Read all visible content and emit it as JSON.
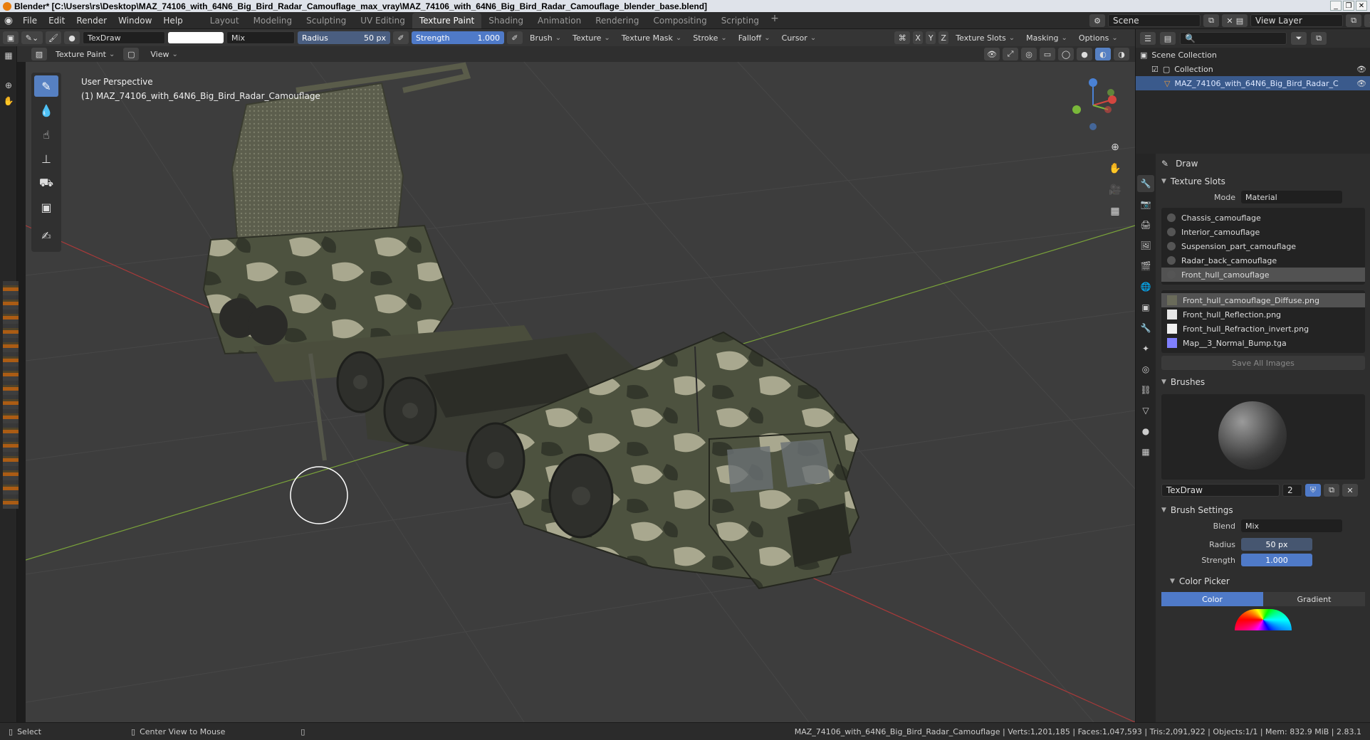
{
  "window": {
    "title": "Blender* [C:\\Users\\rs\\Desktop\\MAZ_74106_with_64N6_Big_Bird_Radar_Camouflage_max_vray\\MAZ_74106_with_64N6_Big_Bird_Radar_Camouflage_blender_base.blend]"
  },
  "menu": {
    "items": [
      "File",
      "Edit",
      "Render",
      "Window",
      "Help"
    ]
  },
  "workspaces": {
    "tabs": [
      "Layout",
      "Modeling",
      "Sculpting",
      "UV Editing",
      "Texture Paint",
      "Shading",
      "Animation",
      "Rendering",
      "Compositing",
      "Scripting"
    ],
    "active": "Texture Paint",
    "add": "+"
  },
  "scene": {
    "name": "Scene",
    "view_layer": "View Layer"
  },
  "toolsettings": {
    "brush_name": "TexDraw",
    "blend": "Mix",
    "radius_label": "Radius",
    "radius_value": "50 px",
    "strength_label": "Strength",
    "strength_value": "1.000",
    "dropdowns": [
      "Brush",
      "Texture",
      "Texture Mask",
      "Stroke",
      "Falloff",
      "Cursor"
    ],
    "axes": [
      "X",
      "Y",
      "Z"
    ],
    "right_dropdowns": [
      "Texture Slots",
      "Masking",
      "Options"
    ]
  },
  "header": {
    "mode": "Texture Paint",
    "view": "View"
  },
  "viewport": {
    "perspective": "User Perspective",
    "object_label": "(1) MAZ_74106_with_64N6_Big_Bird_Radar_Camouflage",
    "colors": {
      "background": "#3d3d3d",
      "grid": "#4a4a4a",
      "x_axis": "#a83a3a",
      "y_axis": "#7aa33a",
      "camo_dark": "#4d523f",
      "camo_light": "#a9a88f"
    }
  },
  "outliner": {
    "scene_collection": "Scene Collection",
    "collection": "Collection",
    "object": "MAZ_74106_with_64N6_Big_Bird_Radar_C"
  },
  "properties": {
    "tool_name": "Draw",
    "texture_slots_title": "Texture Slots",
    "mode_label": "Mode",
    "mode_value": "Material",
    "materials": [
      "Chassis_camouflage",
      "Interior_camouflage",
      "Suspension_part_camouflage",
      "Radar_back_camouflage",
      "Front_hull_camouflage"
    ],
    "active_material": "Front_hull_camouflage",
    "images": [
      "Front_hull_camouflage_Diffuse.png",
      "Front_hull_Reflection.png",
      "Front_hull_Refraction_invert.png",
      "Map__3_Normal_Bump.tga"
    ],
    "active_image": "Front_hull_camouflage_Diffuse.png",
    "save_all": "Save All Images",
    "brushes_title": "Brushes",
    "brush_name": "TexDraw",
    "brush_users": "2",
    "brush_settings_title": "Brush Settings",
    "blend_label": "Blend",
    "blend_value": "Mix",
    "radius_label": "Radius",
    "radius_value": "50 px",
    "strength_label": "Strength",
    "strength_value": "1.000",
    "color_picker_title": "Color Picker",
    "color_tab": "Color",
    "gradient_tab": "Gradient"
  },
  "statusbar": {
    "select": "Select",
    "center_view": "Center View to Mouse",
    "stats": "MAZ_74106_with_64N6_Big_Bird_Radar_Camouflage | Verts:1,201,185 | Faces:1,047,593 | Tris:2,091,922 | Objects:1/1 | Mem: 832.9 MiB | 2.83.1"
  }
}
